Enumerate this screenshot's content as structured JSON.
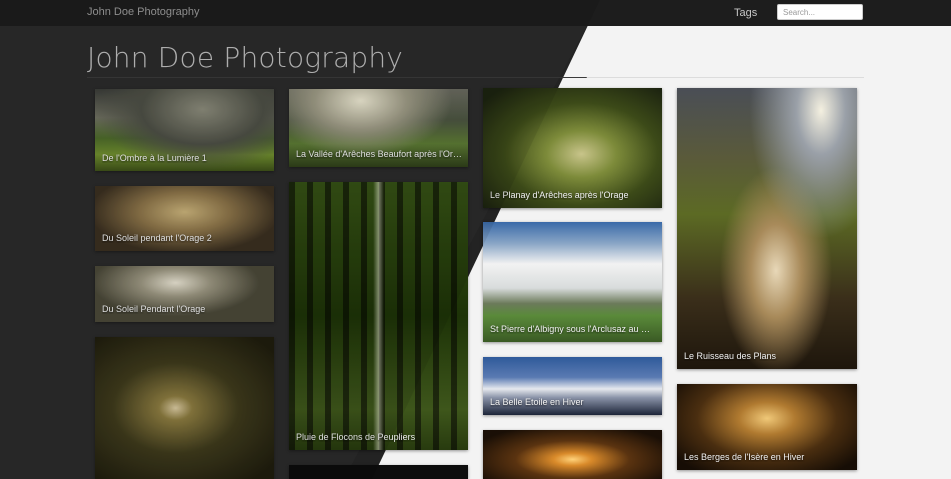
{
  "navbar": {
    "brand": "John Doe Photography",
    "tags_link": "Tags",
    "search_placeholder": "Search..."
  },
  "page": {
    "title": "John Doe Photography"
  },
  "gallery": {
    "col1": [
      {
        "caption": "De l'Ombre à la Lumière 1"
      },
      {
        "caption": "Du Soleil pendant l'Orage 2"
      },
      {
        "caption": "Du Soleil Pendant l'Orage"
      },
      {
        "caption": ""
      }
    ],
    "col2": [
      {
        "caption": "La Vallée d'Arêches Beaufort après l'Orage"
      },
      {
        "caption": "Pluie de Flocons de Peupliers"
      },
      {
        "caption": ""
      }
    ],
    "col3": [
      {
        "caption": "Le Planay d'Arêches après l'Orage"
      },
      {
        "caption": "St Pierre d'Albigny sous l'Arclusaz au Printemps"
      },
      {
        "caption": "La Belle Etoile en Hiver"
      },
      {
        "caption": ""
      }
    ],
    "col4": [
      {
        "caption": "Le Ruisseau des Plans"
      },
      {
        "caption": "Les Berges de l'Isère en Hiver"
      }
    ]
  }
}
